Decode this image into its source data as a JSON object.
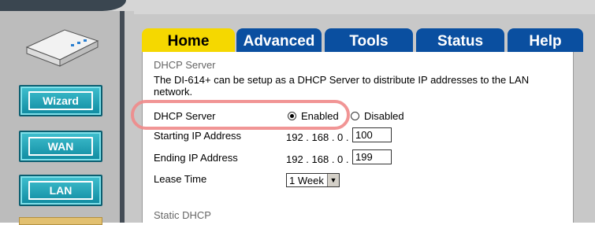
{
  "navigation": {
    "wizard": "Wizard",
    "wan": "WAN",
    "lan": "LAN"
  },
  "tabs": [
    "Home",
    "Advanced",
    "Tools",
    "Status",
    "Help"
  ],
  "section": {
    "title": "DHCP Server",
    "description": "The DI-614+ can be setup as a DHCP Server to distribute IP addresses to the LAN network."
  },
  "form": {
    "dhcp_label": "DHCP Server",
    "enabled_label": "Enabled",
    "disabled_label": "Disabled",
    "dhcp_enabled": true,
    "start_label": "Starting IP Address",
    "end_label": "Ending IP Address",
    "lease_label": "Lease Time",
    "ip_prefix": "192 . 168 . 0 .",
    "start_value": "100",
    "end_value": "199",
    "lease_value": "1 Week"
  },
  "static": {
    "title": "Static DHCP"
  },
  "colors": {
    "active_tab": "#f5d800",
    "tab": "#0a4fa0",
    "nav_button": "#1a9fb4",
    "highlight": "#f08a8a"
  }
}
